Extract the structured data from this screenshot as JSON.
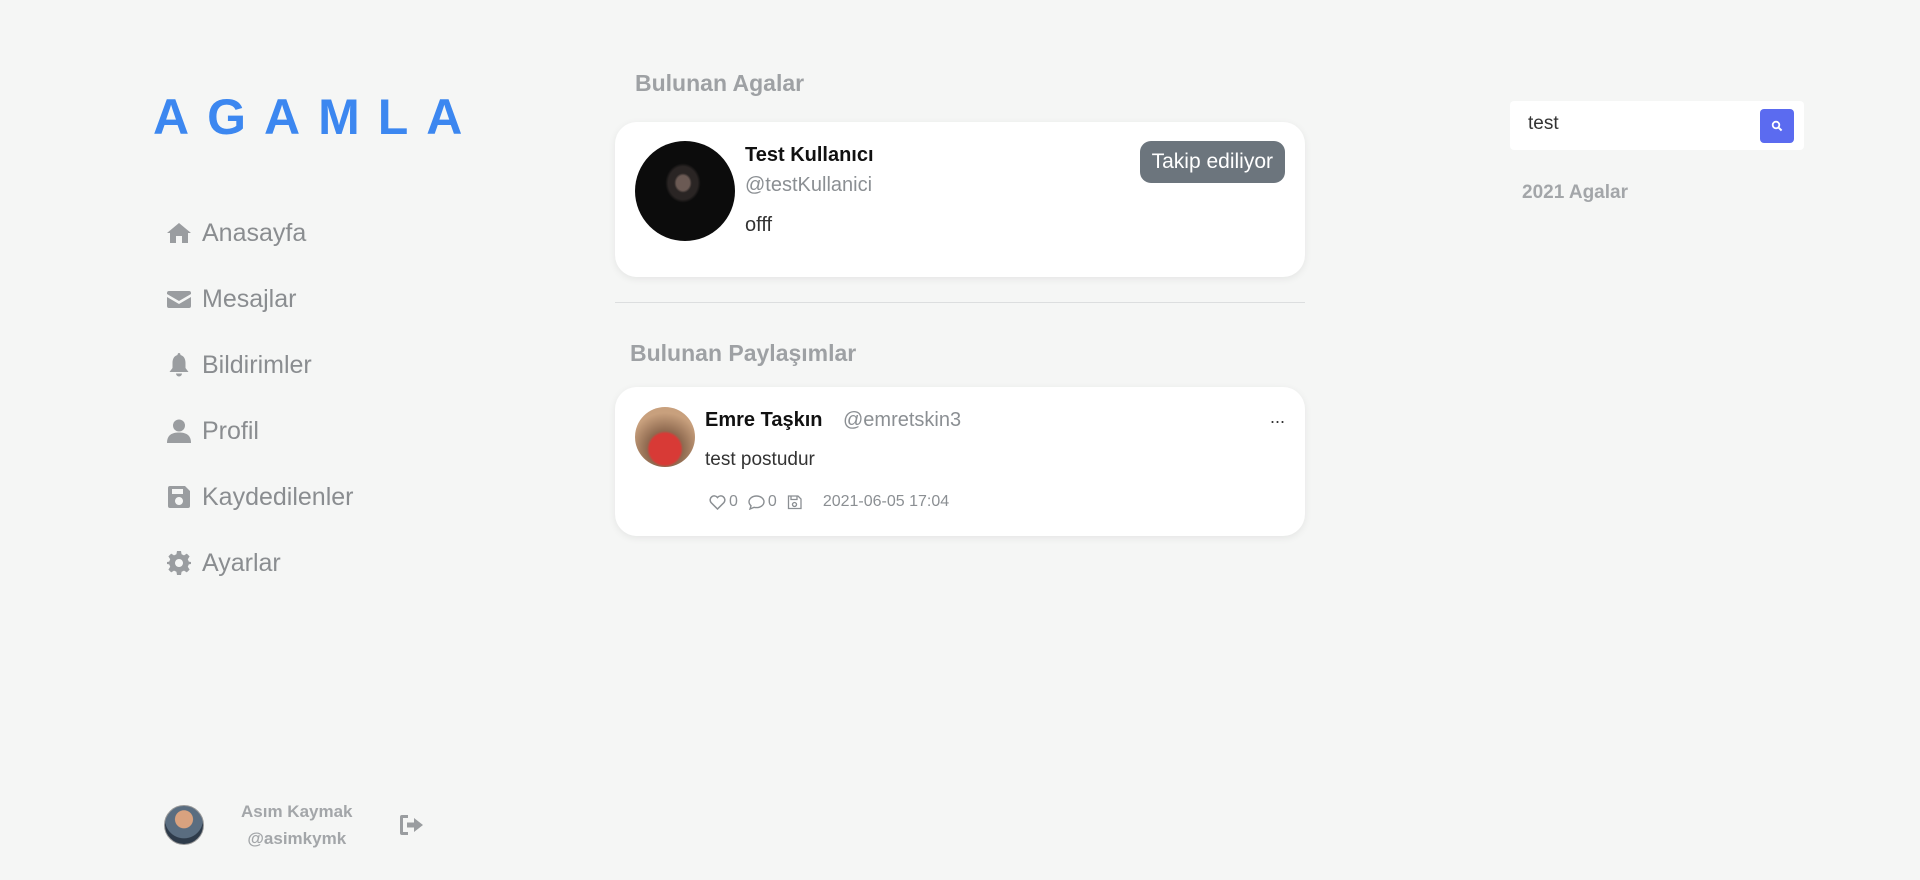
{
  "app": {
    "logo": "AGAMLA"
  },
  "sidebar": {
    "items": [
      {
        "label": "Anasayfa",
        "icon": "home-icon"
      },
      {
        "label": "Mesajlar",
        "icon": "envelope-icon"
      },
      {
        "label": "Bildirimler",
        "icon": "bell-icon"
      },
      {
        "label": "Profil",
        "icon": "user-icon"
      },
      {
        "label": "Kaydedilenler",
        "icon": "save-icon"
      },
      {
        "label": "Ayarlar",
        "icon": "gear-icon"
      }
    ]
  },
  "current_user": {
    "name": "Asım Kaymak",
    "handle": "@asimkymk"
  },
  "results": {
    "agents_title": "Bulunan Agalar",
    "agent": {
      "name": "Test Kullanıcı",
      "handle": "@testKullanici",
      "bio": "offf",
      "follow_label": "Takip ediliyor"
    },
    "posts_title": "Bulunan Paylaşımlar",
    "post": {
      "author": "Emre Taşkın",
      "handle": "@emretskin3",
      "menu": "...",
      "text": "test postudur",
      "likes": "0",
      "comments": "0",
      "date": "2021-06-05 17:04"
    }
  },
  "right": {
    "search_value": "test",
    "heading": "2021 Agalar"
  },
  "colors": {
    "accent": "#3c87f0",
    "search_button": "#5b6bf0",
    "follow_button": "#6c757d"
  }
}
